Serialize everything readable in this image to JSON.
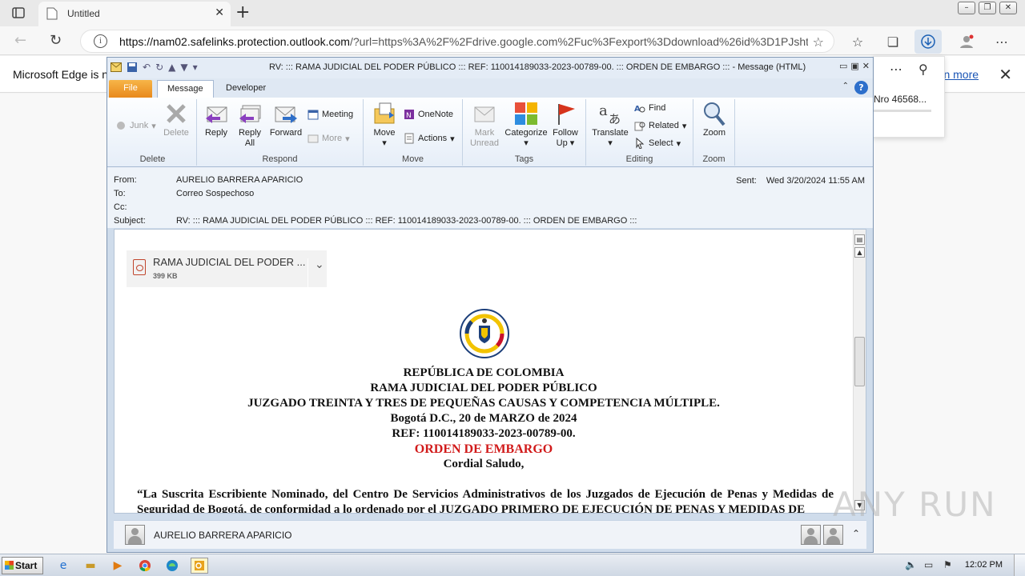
{
  "browser": {
    "tab_title": "Untitled",
    "url_host": "https://nam02.safelinks.protection.outlook.com",
    "url_rest": "/?url=https%3A%2F%2Fdrive.google.com%2Fuc%3Fexport%3Ddownload%26id%3D1PJsht...",
    "infobar_message": "Microsoft Edge is n",
    "infobar_link": "arn more",
    "download_item": "Nro 46568..."
  },
  "outlook": {
    "window_caption": "RV: ::: RAMA JUDICIAL DEL PODER PÚBLICO ::: REF: 110014189033-2023-00789-00. ::: ORDEN DE EMBARGO ::: -  Message (HTML)",
    "tabs": {
      "file": "File",
      "message": "Message",
      "developer": "Developer"
    },
    "ribbon": {
      "delete_group": {
        "label": "Delete",
        "junk": "Junk",
        "delete": "Delete"
      },
      "respond_group": {
        "label": "Respond",
        "reply": "Reply",
        "reply_all_1": "Reply",
        "reply_all_2": "All",
        "forward": "Forward",
        "meeting": "Meeting",
        "more": "More"
      },
      "move_group": {
        "label": "Move",
        "move": "Move",
        "onenote": "OneNote",
        "actions": "Actions"
      },
      "tags_group": {
        "label": "Tags",
        "mark_unread_1": "Mark",
        "mark_unread_2": "Unread",
        "categorize": "Categorize",
        "follow_up_1": "Follow",
        "follow_up_2": "Up"
      },
      "editing_group": {
        "label": "Editing",
        "translate": "Translate",
        "find": "Find",
        "related": "Related",
        "select": "Select"
      },
      "zoom_group": {
        "label": "Zoom",
        "zoom": "Zoom"
      }
    },
    "headers": {
      "from_label": "From:",
      "from": "AURELIO  BARRERA APARICIO",
      "to_label": "To:",
      "to": "Correo Sospechoso",
      "cc_label": "Cc:",
      "cc": "",
      "subject_label": "Subject:",
      "subject": "RV: ::: RAMA JUDICIAL DEL PODER PÚBLICO ::: REF: 110014189033-2023-00789-00. ::: ORDEN DE EMBARGO :::",
      "sent_label": "Sent:",
      "sent": "Wed 3/20/2024 11:55 AM"
    },
    "attachment": {
      "name": "RAMA JUDICIAL DEL PODER ...",
      "size": "399 KB"
    },
    "document": {
      "line1": "REPÚBLICA DE COLOMBIA",
      "line2": "RAMA JUDICIAL DEL PODER PÚBLICO",
      "line3": "JUZGADO TREINTA Y TRES DE PEQUEÑAS CAUSAS Y COMPETENCIA MÚLTIPLE.",
      "line4": "Bogotá D.C.,  20 de MARZO de 2024",
      "line5": "REF: 110014189033-2023-00789-00.",
      "line6": "ORDEN DE EMBARGO",
      "line7": "Cordial Saludo,",
      "paragraph": "“La Suscrita Escribiente Nominado, del Centro De Servicios Administrativos de los Juzgados de Ejecución de Penas y Medidas de Seguridad de Bogotá, de conformidad a lo ordenado por el JUZGADO PRIMERO DE EJECUCIÓN DE PENAS Y MEDIDAS DE"
    },
    "people_pane_name": "AURELIO  BARRERA APARICIO"
  },
  "taskbar": {
    "start": "Start",
    "clock": "12:02 PM"
  },
  "watermark": "ANY RUN",
  "colors": {
    "accent_red": "#d11a1a",
    "file_tab": "#e8891c",
    "link": "#1a55b5"
  }
}
